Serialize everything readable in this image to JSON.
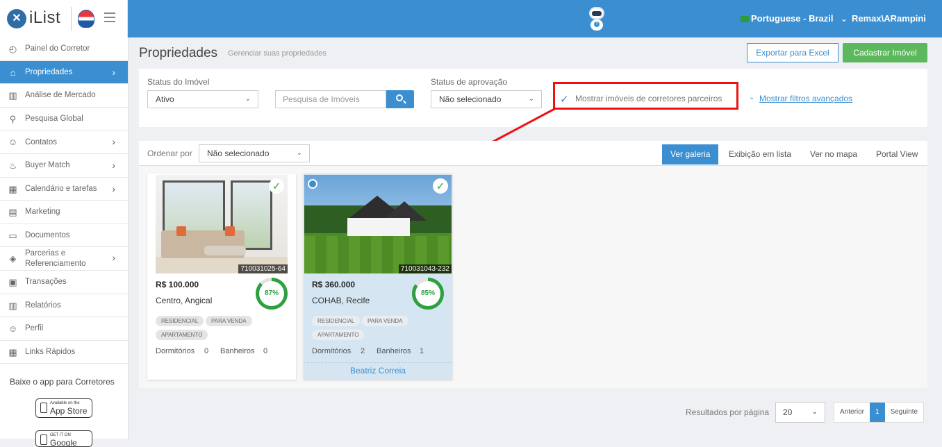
{
  "header": {
    "logo_text": "iList",
    "language": "Portuguese - Brazil",
    "user": "Remax\\ARampini"
  },
  "sidebar": {
    "items": [
      {
        "label": "Painel do Corretor",
        "icon": "gauge-icon"
      },
      {
        "label": "Propriedades",
        "icon": "home-icon"
      },
      {
        "label": "Análise de Mercado",
        "icon": "bar-chart-icon"
      },
      {
        "label": "Pesquisa Global",
        "icon": "search-icon"
      },
      {
        "label": "Contatos",
        "icon": "contacts-icon"
      },
      {
        "label": "Buyer Match",
        "icon": "fire-icon"
      },
      {
        "label": "Calendário e tarefas",
        "icon": "calendar-icon"
      },
      {
        "label": "Marketing",
        "icon": "marketing-icon"
      },
      {
        "label": "Documentos",
        "icon": "folder-icon"
      },
      {
        "label": "Parcerias e Referenciamento",
        "icon": "tag-icon"
      },
      {
        "label": "Transações",
        "icon": "briefcase-icon"
      },
      {
        "label": "Relatórios",
        "icon": "report-icon"
      },
      {
        "label": "Perfil",
        "icon": "user-icon"
      },
      {
        "label": "Links Rápidos",
        "icon": "links-icon"
      }
    ],
    "app_title": "Baixe o app para Corretores",
    "app_store_small": "Available on the",
    "app_store_big": "App Store",
    "google_small": "GET IT ON",
    "google_big": "Google Play"
  },
  "page": {
    "title": "Propriedades",
    "subtitle": "Gerenciar suas propriedades",
    "export_label": "Exportar para Excel",
    "add_label": "Cadastrar Imóvel"
  },
  "filters": {
    "status_label": "Status do Imóvel",
    "status_value": "Ativo",
    "search_placeholder": "Pesquisa de Imóveis",
    "approval_label": "Status de aprovação",
    "approval_value": "Não selecionado",
    "partner_label": "Mostrar imóveis de corretores parceiros",
    "advanced_label": "Mostrar filtros avançados"
  },
  "toolbar": {
    "sort_label": "Ordenar por",
    "sort_value": "Não selecionado",
    "views": [
      "Ver galeria",
      "Exibição em lista",
      "Ver no mapa",
      "Portal View"
    ]
  },
  "listings": [
    {
      "ref": "710031025-64",
      "price": "R$ 100.000",
      "location": "Centro, Angical",
      "score": "87%",
      "tags": [
        "RESIDENCIAL",
        "PARA VENDA",
        "APARTAMENTO"
      ],
      "bedrooms_label": "Dormitórios",
      "bedrooms": "0",
      "bathrooms_label": "Banheiros",
      "bathrooms": "0"
    },
    {
      "ref": "710031043-232",
      "price": "R$ 360.000",
      "location": "COHAB, Recife",
      "score": "85%",
      "tags": [
        "RESIDENCIAL",
        "PARA VENDA",
        "APARTAMENTO"
      ],
      "bedrooms_label": "Dormitórios",
      "bedrooms": "2",
      "bathrooms_label": "Banheiros",
      "bathrooms": "1",
      "agent": "Beatriz Correia"
    }
  ],
  "pagination": {
    "per_page_label": "Resultados por página",
    "per_page_value": "20",
    "prev": "Anterior",
    "current": "1",
    "next": "Seguinte"
  },
  "colors": {
    "accent": "#3b8fd1",
    "success": "#5cb85c",
    "annotation": "#e11111"
  }
}
